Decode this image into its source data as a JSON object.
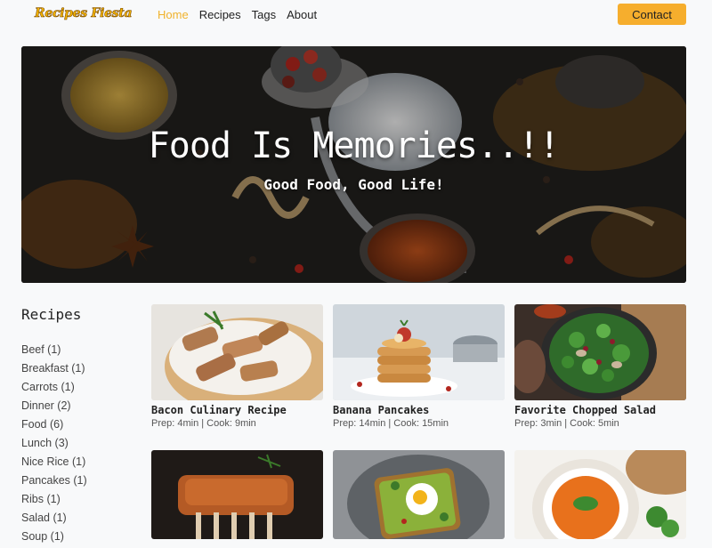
{
  "nav": {
    "brand": "Recipes Fiesta",
    "links": [
      "Home",
      "Recipes",
      "Tags",
      "About"
    ],
    "active": "Home",
    "contact_label": "Contact"
  },
  "hero": {
    "title": "Food Is Memories..!!",
    "subtitle": "Good Food, Good Life!"
  },
  "sidebar": {
    "title": "Recipes",
    "tags": [
      "Beef (1)",
      "Breakfast (1)",
      "Carrots (1)",
      "Dinner (2)",
      "Food (6)",
      "Lunch (3)",
      "Nice Rice (1)",
      "Pancakes (1)",
      "Ribs (1)",
      "Salad (1)",
      "Soup (1)"
    ]
  },
  "recipes": [
    {
      "title": "Bacon Culinary Recipe",
      "meta": "Prep: 4min | Cook: 9min",
      "image": "bacon-skewers"
    },
    {
      "title": "Banana Pancakes",
      "meta": "Prep: 14min | Cook: 15min",
      "image": "pancakes"
    },
    {
      "title": "Favorite Chopped Salad",
      "meta": "Prep: 3min | Cook: 5min",
      "image": "salad"
    },
    {
      "image": "ribs"
    },
    {
      "image": "avocado-toast"
    },
    {
      "image": "carrot-soup"
    }
  ],
  "colors": {
    "accent": "#f6ae2d",
    "active_link": "#f0b22b",
    "background": "#f8f9fa"
  }
}
